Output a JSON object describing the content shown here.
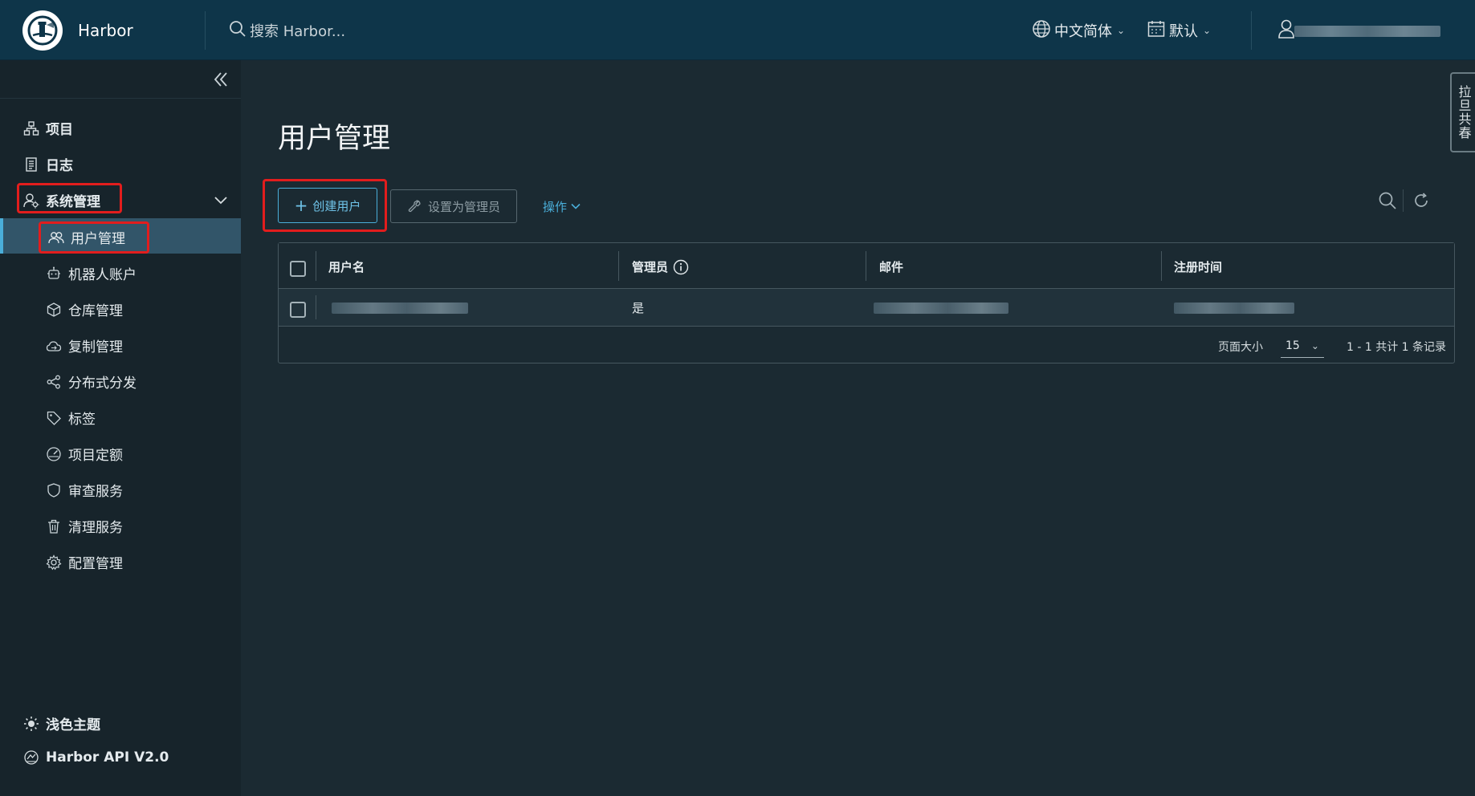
{
  "header": {
    "brand": "Harbor",
    "search_placeholder": "搜索 Harbor...",
    "language": "中文简体",
    "calendar": "默认"
  },
  "sidebar": {
    "items": [
      {
        "label": "项目",
        "icon": "projects-icon"
      },
      {
        "label": "日志",
        "icon": "logs-icon"
      },
      {
        "label": "系统管理",
        "icon": "admin-icon"
      }
    ],
    "subitems": [
      {
        "label": "用户管理",
        "icon": "users-icon"
      },
      {
        "label": "机器人账户",
        "icon": "robot-icon"
      },
      {
        "label": "仓库管理",
        "icon": "box-icon"
      },
      {
        "label": "复制管理",
        "icon": "cloud-icon"
      },
      {
        "label": "分布式分发",
        "icon": "share-icon"
      },
      {
        "label": "标签",
        "icon": "tag-icon"
      },
      {
        "label": "项目定额",
        "icon": "dashboard-icon"
      },
      {
        "label": "审查服务",
        "icon": "shield-icon"
      },
      {
        "label": "清理服务",
        "icon": "trash-icon"
      },
      {
        "label": "配置管理",
        "icon": "gear-icon"
      }
    ],
    "footer": [
      {
        "label": "浅色主题",
        "icon": "sun-icon"
      },
      {
        "label": "Harbor API V2.0",
        "icon": "api-icon"
      }
    ]
  },
  "main": {
    "title": "用户管理",
    "create_user": "创建用户",
    "set_admin": "设置为管理员",
    "actions": "操作"
  },
  "table": {
    "columns": [
      "用户名",
      "管理员",
      "邮件",
      "注册时间"
    ],
    "rows": [
      {
        "admin": "是"
      }
    ],
    "footer": {
      "page_size_label": "页面大小",
      "page_size": "15",
      "summary": "1 - 1 共计 1 条记录"
    }
  },
  "side_tab": "拉旦共春",
  "colors": {
    "header_bg": "#0e3549",
    "sidebar_bg": "#17242b",
    "content_bg": "#1b2a32",
    "accent": "#4aaed9",
    "highlight_red": "#e21d1d"
  }
}
